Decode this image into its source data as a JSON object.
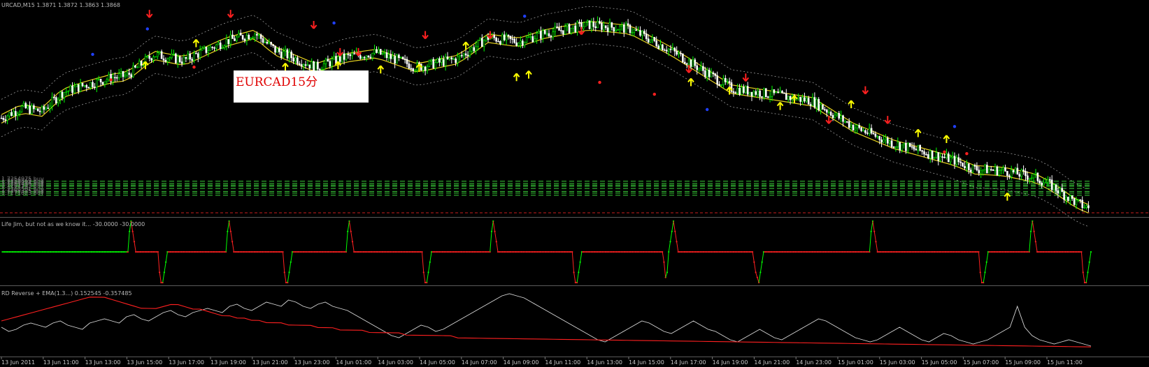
{
  "header": {
    "title": "URCAD,M15  1.3871 1.3872 1.3863 1.3868"
  },
  "note": {
    "label": "EURCAD15分"
  },
  "buy_levels": [
    {
      "label": "1.7254975 buy",
      "price": 1.37255
    },
    {
      "label": "1.7259869 buy",
      "price": 1.37228
    },
    {
      "label": "1.7260974 buy",
      "price": 1.3721
    },
    {
      "label": "1.7261486 buy",
      "price": 1.37195
    },
    {
      "label": "1.7262143 buy",
      "price": 1.3717
    },
    {
      "label": "1.7263581 buy",
      "price": 1.37135
    },
    {
      "label": "1.7265325 buy",
      "price": 1.37115
    },
    {
      "label": "1.7271623 buy",
      "price": 1.3709
    }
  ],
  "indicator1": {
    "label": "Life Jim, but not as we know it... -30.0000 -30.0000",
    "min": -30,
    "max": 30
  },
  "indicator2": {
    "label": "RD Reverse + EMA(1.3...) 0.152545 -0.357485"
  },
  "colors": {
    "background": "#000000",
    "bull": "#00ff00",
    "bear": "#ffffff",
    "channel": "#e6d21e",
    "envelope": "#9a9a9a",
    "buy_line": "#3ad13a",
    "osc_up": "#00ff00",
    "osc_down": "#ff2020",
    "signal": "#ff2020",
    "line": "#d8d8d8"
  },
  "chart_data": [
    {
      "type": "candlestick",
      "symbol": "EURCAD",
      "timeframe": "M15",
      "x_ticks": [
        "13 Jun 2011",
        "13 Jun 11:00",
        "13 Jun 13:00",
        "13 Jun 15:00",
        "13 Jun 17:00",
        "13 Jun 19:00",
        "13 Jun 21:00",
        "13 Jun 23:00",
        "14 Jun 01:00",
        "14 Jun 03:00",
        "14 Jun 05:00",
        "14 Jun 07:00",
        "14 Jun 09:00",
        "14 Jun 11:00",
        "14 Jun 13:00",
        "14 Jun 15:00",
        "14 Jun 17:00",
        "14 Jun 19:00",
        "14 Jun 21:00",
        "14 Jun 23:00",
        "15 Jun 01:00",
        "15 Jun 03:00",
        "15 Jun 05:00",
        "15 Jun 07:00",
        "15 Jun 09:00",
        "15 Jun 11:00"
      ],
      "close_path": [
        [
          0,
          1.38
        ],
        [
          10,
          1.3812
        ],
        [
          20,
          1.3808
        ],
        [
          30,
          1.383
        ],
        [
          40,
          1.3838
        ],
        [
          55,
          1.3848
        ],
        [
          62,
          1.385
        ],
        [
          75,
          1.3875
        ],
        [
          90,
          1.3868
        ],
        [
          110,
          1.389
        ],
        [
          125,
          1.39
        ],
        [
          135,
          1.388
        ],
        [
          155,
          1.386
        ],
        [
          170,
          1.3872
        ],
        [
          185,
          1.3877
        ],
        [
          205,
          1.386
        ],
        [
          225,
          1.387
        ],
        [
          240,
          1.3895
        ],
        [
          255,
          1.389
        ],
        [
          268,
          1.39
        ],
        [
          290,
          1.391
        ],
        [
          310,
          1.3905
        ],
        [
          330,
          1.388
        ],
        [
          350,
          1.385
        ],
        [
          360,
          1.3835
        ],
        [
          374,
          1.383
        ],
        [
          400,
          1.382
        ],
        [
          420,
          1.379
        ],
        [
          440,
          1.377
        ],
        [
          455,
          1.376
        ],
        [
          470,
          1.375
        ],
        [
          480,
          1.374
        ],
        [
          494,
          1.3738
        ],
        [
          510,
          1.373
        ],
        [
          518,
          1.372
        ],
        [
          524,
          1.371
        ],
        [
          530,
          1.37
        ],
        [
          536,
          1.3694
        ]
      ],
      "up_arrows": [
        [
          71,
          1.386
        ],
        [
          96,
          1.3886
        ],
        [
          140,
          1.3858
        ],
        [
          166,
          1.386
        ],
        [
          187,
          1.3855
        ],
        [
          206,
          1.3857
        ],
        [
          229,
          1.3883
        ],
        [
          254,
          1.3846
        ],
        [
          260,
          1.3849
        ],
        [
          340,
          1.384
        ],
        [
          359,
          1.383
        ],
        [
          384,
          1.3812
        ],
        [
          391,
          1.382
        ],
        [
          419,
          1.3814
        ],
        [
          452,
          1.378
        ],
        [
          466,
          1.3773
        ],
        [
          496,
          1.3705
        ]
      ],
      "down_arrows": [
        [
          73,
          1.3925
        ],
        [
          113,
          1.3925
        ],
        [
          154,
          1.3912
        ],
        [
          167,
          1.388
        ],
        [
          176,
          1.388
        ],
        [
          209,
          1.39
        ],
        [
          241,
          1.39
        ],
        [
          286,
          1.3905
        ],
        [
          339,
          1.386
        ],
        [
          367,
          1.385
        ],
        [
          408,
          1.38
        ],
        [
          426,
          1.3835
        ],
        [
          437,
          1.38
        ]
      ]
    },
    {
      "type": "line",
      "name": "Life Jim, but not as we know it...",
      "ylim": [
        -30,
        30
      ],
      "values": [
        0,
        0,
        0,
        0,
        0,
        0,
        0,
        0,
        0,
        0,
        0,
        0,
        0,
        0,
        0,
        0,
        0,
        0,
        0,
        0,
        0,
        0,
        0,
        0,
        0,
        0,
        0,
        0,
        0,
        0,
        0,
        0,
        0,
        0,
        0,
        0,
        0,
        0,
        0,
        0,
        0,
        0,
        0,
        0,
        0,
        0,
        0,
        0,
        0,
        0,
        0,
        0,
        0,
        0,
        0,
        0,
        0,
        0,
        0,
        0,
        0,
        0,
        0,
        0,
        0,
        0,
        0,
        0,
        0,
        0,
        0,
        0,
        0,
        0,
        0,
        0,
        0,
        0,
        0,
        0,
        0,
        20,
        30,
        20,
        10,
        0,
        0,
        0,
        0,
        0,
        0,
        0,
        0,
        0,
        0,
        0,
        0,
        0,
        0,
        0,
        -20,
        -30,
        -30,
        -20,
        -10,
        0,
        0,
        0,
        0,
        0,
        0,
        0,
        0,
        0,
        0,
        0,
        0,
        0,
        0,
        0,
        0,
        0,
        0,
        0,
        0,
        0,
        0,
        0,
        0,
        0,
        0,
        0,
        0,
        0,
        0,
        0,
        0,
        0,
        0,
        0,
        0,
        0,
        0,
        20,
        30,
        20,
        10,
        0,
        0,
        0,
        0,
        0,
        0,
        0,
        0,
        0,
        0,
        0,
        0,
        0,
        0,
        0,
        0,
        0,
        0,
        0,
        0,
        0,
        0,
        0,
        0,
        0,
        0,
        0,
        0,
        0,
        0,
        0,
        0,
        -20,
        -30,
        -30,
        -20,
        -10,
        0,
        0,
        0,
        0,
        0,
        0,
        0,
        0,
        0,
        0,
        0,
        0,
        0,
        0,
        0,
        0,
        0,
        0,
        0,
        0,
        0,
        0,
        0,
        0,
        0,
        0,
        0,
        0,
        0,
        0,
        0,
        0,
        0,
        0,
        0,
        20,
        30,
        20,
        10,
        0,
        0,
        0,
        0,
        0,
        0,
        0,
        0,
        0,
        0,
        0,
        0,
        0,
        0,
        0,
        0,
        0,
        0,
        0,
        0,
        0,
        0,
        0,
        0,
        0,
        0,
        0,
        0,
        0,
        0,
        0,
        0,
        0,
        0,
        0,
        0,
        0,
        0,
        0,
        0,
        0,
        0,
        0,
        0,
        -20,
        -30,
        -30,
        -20,
        -10,
        0,
        0,
        0,
        0,
        0,
        0,
        0,
        0,
        0,
        0,
        0,
        0,
        0,
        0,
        0,
        0,
        0,
        0,
        0,
        0,
        0,
        0,
        0,
        0,
        0,
        0,
        0,
        0,
        0,
        0,
        0,
        0,
        0,
        0,
        0,
        0,
        0,
        0,
        20,
        30,
        20,
        10,
        0,
        0,
        0,
        0,
        0,
        0,
        0,
        0,
        0,
        0,
        0,
        0,
        0,
        0,
        0,
        0,
        0,
        0,
        0,
        0,
        0,
        0,
        0,
        0,
        0,
        0,
        0,
        0,
        0,
        0,
        0,
        0,
        0,
        0,
        0,
        0,
        0,
        0,
        0,
        0,
        0,
        0,
        0,
        0,
        0,
        0,
        0,
        0,
        -20,
        -30,
        -30,
        -20,
        -10,
        0,
        0,
        0,
        0,
        0,
        0,
        0,
        0,
        0,
        0,
        0,
        0,
        0,
        0,
        0,
        0,
        0,
        0,
        0,
        0,
        0,
        0,
        0,
        0,
        0,
        0,
        0,
        0,
        0,
        0,
        0,
        0,
        0,
        0,
        0,
        0,
        0,
        0,
        0,
        0,
        0,
        0,
        0,
        0,
        0,
        0,
        0,
        0,
        0,
        0,
        0,
        0,
        -10,
        -25,
        -20,
        0,
        10,
        20,
        30,
        20,
        10,
        0,
        0,
        0,
        0,
        0,
        0,
        0,
        0,
        0,
        0,
        0,
        0,
        0,
        0,
        0,
        0,
        0,
        0,
        0,
        0,
        0,
        0,
        0,
        0,
        0,
        0,
        0,
        0,
        0,
        0,
        0,
        0,
        0,
        0,
        0,
        0,
        0,
        0,
        0,
        0,
        0,
        0,
        0,
        0,
        0,
        0,
        0,
        0,
        -10,
        -20,
        -25,
        -30,
        -20,
        -10,
        0,
        0,
        0,
        0,
        0,
        0,
        0,
        0,
        0,
        0,
        0,
        0,
        0,
        0,
        0,
        0,
        0,
        0,
        0,
        0,
        0,
        0,
        0,
        0,
        0,
        0,
        0,
        0,
        0,
        0,
        0,
        0,
        0,
        0,
        0,
        0,
        0,
        0,
        0,
        0,
        0,
        0,
        0,
        0,
        0,
        0,
        0,
        0,
        0,
        0,
        0,
        0,
        0,
        0,
        0,
        0,
        0,
        0,
        0,
        0,
        0,
        0,
        0,
        0,
        0,
        0,
        0,
        0,
        20,
        30,
        20,
        10,
        0,
        0,
        0,
        0,
        0,
        0,
        0,
        0,
        0,
        0,
        0,
        0,
        0,
        0,
        0,
        0,
        0,
        0,
        0,
        0,
        0,
        0,
        0,
        0,
        0,
        0,
        0,
        0,
        0,
        0,
        0,
        0,
        0,
        0,
        0,
        0,
        0,
        0,
        0,
        0,
        0,
        0,
        0,
        0,
        0,
        0,
        0,
        0,
        0,
        0,
        0,
        0,
        0,
        0,
        0,
        0,
        0,
        0,
        0,
        0,
        0,
        0,
        0,
        0,
        0,
        -20,
        -30,
        -30,
        -20,
        -10,
        0,
        0,
        0,
        0,
        0,
        0,
        0,
        0,
        0,
        0,
        0,
        0,
        0,
        0,
        0,
        0,
        0,
        0,
        0,
        0,
        0,
        0,
        0,
        0,
        0,
        0,
        0,
        20,
        30,
        20,
        10,
        0,
        0,
        0,
        0,
        0,
        0,
        0,
        0,
        0,
        0,
        0,
        0,
        0,
        0,
        0,
        0,
        0,
        0,
        0,
        0,
        0,
        0,
        0,
        0,
        0,
        0,
        0,
        0,
        0,
        -20,
        -30,
        -30,
        -20,
        -10,
        0
      ],
      "values_note": ""
    },
    {
      "type": "line",
      "name": "RD Reverse + EMA",
      "series": [
        {
          "name": "RD Reverse",
          "values": [
            0.12,
            0.1,
            0.11,
            0.13,
            0.14,
            0.13,
            0.12,
            0.14,
            0.15,
            0.13,
            0.12,
            0.11,
            0.14,
            0.15,
            0.16,
            0.15,
            0.14,
            0.17,
            0.18,
            0.16,
            0.15,
            0.17,
            0.19,
            0.2,
            0.18,
            0.17,
            0.19,
            0.2,
            0.21,
            0.2,
            0.19,
            0.22,
            0.23,
            0.21,
            0.2,
            0.22,
            0.24,
            0.23,
            0.22,
            0.25,
            0.24,
            0.22,
            0.21,
            0.23,
            0.24,
            0.22,
            0.21,
            0.2,
            0.18,
            0.16,
            0.14,
            0.12,
            0.1,
            0.08,
            0.07,
            0.09,
            0.11,
            0.13,
            0.12,
            0.1,
            0.11,
            0.13,
            0.15,
            0.17,
            0.19,
            0.21,
            0.23,
            0.25,
            0.27,
            0.28,
            0.27,
            0.26,
            0.24,
            0.22,
            0.2,
            0.18,
            0.16,
            0.14,
            0.12,
            0.1,
            0.08,
            0.06,
            0.05,
            0.07,
            0.09,
            0.11,
            0.13,
            0.15,
            0.14,
            0.12,
            0.1,
            0.09,
            0.11,
            0.13,
            0.15,
            0.13,
            0.11,
            0.1,
            0.08,
            0.06,
            0.05,
            0.07,
            0.09,
            0.11,
            0.09,
            0.07,
            0.06,
            0.08,
            0.1,
            0.12,
            0.14,
            0.16,
            0.15,
            0.13,
            0.11,
            0.09,
            0.07,
            0.06,
            0.05,
            0.06,
            0.08,
            0.1,
            0.12,
            0.1,
            0.08,
            0.06,
            0.05,
            0.07,
            0.09,
            0.08,
            0.06,
            0.05,
            0.04,
            0.05,
            0.06,
            0.08,
            0.1,
            0.12,
            0.22,
            0.12,
            0.08,
            0.06,
            0.05,
            0.04,
            0.05,
            0.06,
            0.05,
            0.04,
            0.03
          ]
        },
        {
          "name": "EMA",
          "values": [
            0.05,
            0.06,
            0.07,
            0.08,
            0.09,
            0.1,
            0.11,
            0.12,
            0.13,
            0.14,
            0.15,
            0.16,
            0.17,
            0.17,
            0.17,
            0.16,
            0.15,
            0.14,
            0.13,
            0.12,
            0.12,
            0.12,
            0.13,
            0.14,
            0.14,
            0.13,
            0.12,
            0.12,
            0.11,
            0.1,
            0.09,
            0.09,
            0.08,
            0.08,
            0.07,
            0.07,
            0.06,
            0.06,
            0.06,
            0.05,
            0.05,
            0.05,
            0.05,
            0.04,
            0.04,
            0.04,
            0.03,
            0.03,
            0.03,
            0.03,
            0.02,
            0.02,
            0.02,
            0.02,
            0.02,
            0.01,
            0.01,
            0.01,
            0.01,
            0.01,
            0.01,
            0.01,
            0.0,
            0.0,
            0.0,
            0.0,
            0.0,
            0.0,
            0.0,
            0.0,
            0.0,
            0.0,
            0.0,
            0.0,
            0.0,
            0.0,
            0.0,
            0.0,
            0.0,
            0.0,
            0.0,
            0.0,
            0.0,
            0.0,
            0.0,
            0.0,
            0.0,
            0.0,
            0.0,
            0.0,
            0.0,
            0.0,
            0.0,
            0.0,
            0.0,
            0.0,
            0.0,
            0.0,
            0.0,
            0.0,
            0.0,
            0.0,
            0.0,
            0.0,
            0.0,
            0.0,
            0.0,
            0.0,
            0.0,
            0.0,
            0.0,
            0.0,
            0.0,
            0.0,
            0.0,
            0.0,
            0.0,
            0.0,
            0.0,
            0.0,
            0.0,
            0.0,
            0.0,
            0.0,
            0.0,
            0.0,
            0.0,
            0.0,
            0.0,
            0.0,
            0.0,
            0.0,
            0.0,
            0.0,
            0.0,
            0.0,
            0.0,
            0.0,
            0.0,
            0.0,
            0.0,
            0.0,
            0.0,
            0.0,
            0.0,
            0.0,
            0.0,
            0.0,
            0.0
          ]
        }
      ]
    }
  ]
}
